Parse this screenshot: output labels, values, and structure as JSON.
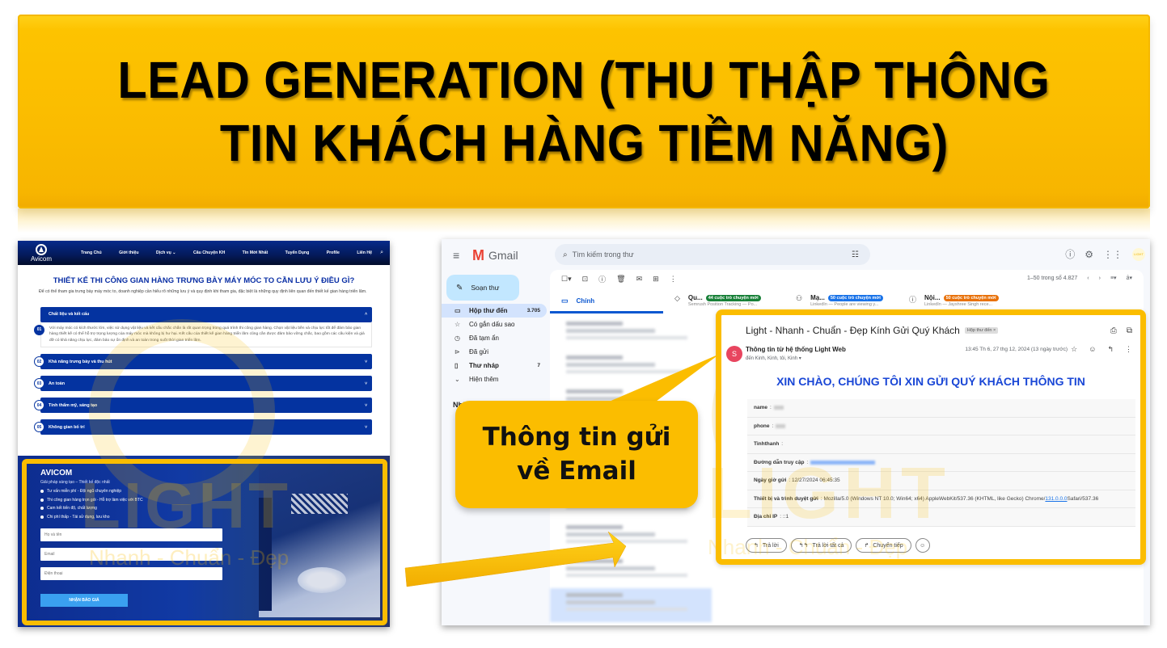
{
  "banner": {
    "line1": "LEAD GENERATION (THU THẬP THÔNG",
    "line2": "TIN KHÁCH HÀNG TIỀM NĂNG)"
  },
  "website": {
    "logo_text": "Avicom",
    "nav": [
      "Trang Chủ",
      "Giới thiệu",
      "Dịch vụ ⌄",
      "Câu Chuyện KH",
      "Tin Mới Nhất",
      "Tuyển Dụng",
      "Profile",
      "Liên Hệ"
    ],
    "title": "THIẾT KẾ THI CÔNG GIAN HÀNG TRƯNG BÀY MÁY MÓC TO CẦN LƯU Ý ĐIỀU GÌ?",
    "intro": "Để có thể tham gia trưng bày máy móc to, doanh nghiệp cần hiểu rõ những lưu ý và quy định khi tham gia, đặc biệt là những quy định liên quan đến thiết kế gian hàng triển lãm.",
    "accordion": [
      {
        "num": "01",
        "title": "Chất liệu và kết cấu",
        "open": true,
        "body": "Với máy móc có kích thước lớn, việc sử dụng vật liệu và kết cấu chắc chắn là rất quan trọng trong quá trình thi công gian hàng. Chọn vật liệu bền và chịu lực tốt để đảm bảo gian hàng thiết kế có thể hỗ trợ trọng lượng của máy móc mà không bị hư hại. Kết cấu của thiết kế gian hàng triển lãm cũng cần được đảm bảo vững chắc, bao gồm các cấu kiện và giá đỡ có khả năng chịu lực, đảm bảo sự ổn định và an toàn trong suốt thời gian triển lãm."
      },
      {
        "num": "02",
        "title": "Khả năng trưng bày và thu hút",
        "open": false
      },
      {
        "num": "03",
        "title": "An toàn",
        "open": false
      },
      {
        "num": "04",
        "title": "Tính thẩm mỹ, sáng tạo",
        "open": false
      },
      {
        "num": "05",
        "title": "Không gian bố trí",
        "open": false
      }
    ],
    "form": {
      "brand": "AVICOM",
      "subtitle": "Giải pháp sáng tạo – Thiết kế độc nhất",
      "bullets": [
        "Tư vấn miễn phí - Đội ngũ chuyên nghiệp",
        "Thi công gian hàng trọn gói - Hỗ trợ làm việc với BTC",
        "Cam kết tiến độ, chất lượng",
        "Chi phí thấp - Tái sử dụng, lưu kho"
      ],
      "name_placeholder": "Họ và tên",
      "email_placeholder": "Email",
      "phone_placeholder": "Điện thoại",
      "submit_label": "NHẬN BÁO GIÁ"
    }
  },
  "watermark": {
    "brand": "LIGHT",
    "slogan": "Nhanh - Chuẩn - Đẹp"
  },
  "gmail": {
    "brand": "Gmail",
    "search_placeholder": "Tìm kiếm trong thư",
    "compose_label": "Soạn thư",
    "nav": [
      {
        "icon": "inbox-icon",
        "glyph": "▭",
        "label": "Hộp thư đến",
        "count": "3.705",
        "active": true
      },
      {
        "icon": "star-icon",
        "glyph": "☆",
        "label": "Có gắn dấu sao",
        "count": ""
      },
      {
        "icon": "clock-icon",
        "glyph": "◷",
        "label": "Đã tạm ẩn",
        "count": ""
      },
      {
        "icon": "send-icon",
        "glyph": "⊳",
        "label": "Đã gửi",
        "count": ""
      },
      {
        "icon": "draft-icon",
        "glyph": "▯",
        "label": "Thư nháp",
        "count": "7",
        "bold": true
      },
      {
        "icon": "chevron-down-icon",
        "glyph": "⌄",
        "label": "Hiện thêm",
        "count": ""
      }
    ],
    "labels_heading": "Nhã",
    "pager_text": "1–50 trong số 4.827",
    "tabs": {
      "primary": "Chính",
      "promotions": {
        "name": "Qu...",
        "chip": "44 cuộc trò chuyện mới",
        "sub": "Semrush Position Tracking — Po..."
      },
      "social": {
        "name": "Mạ...",
        "chip": "50 cuộc trò chuyện mới",
        "sub": "LinkedIn — People are viewing y..."
      },
      "updates": {
        "name": "Nội...",
        "chip": "50 cuộc trò chuyện mới",
        "sub": "LinkedIn — Jayshree Singh rece..."
      }
    },
    "avatar_text": "LIGHT",
    "email": {
      "subject": "Light - Nhanh - Chuẩn - Đẹp Kính Gửi Quý Khách",
      "folder_badge": "Hộp thư đến ×",
      "sender_initial": "S",
      "sender": "Thông tin từ hệ thống Light Web",
      "recipients": "đến Kinh, Kinh, tôi, Kinh ▾",
      "date": "13:45 Th 6, 27 thg 12, 2024 (13 ngày trước)",
      "heading": "XIN CHÀO, CHÚNG TÔI XIN GỬI QUÝ KHÁCH THÔNG TIN",
      "fields": [
        {
          "label": "name",
          "value": "",
          "redacted": true
        },
        {
          "label": "phone",
          "value": "",
          "redacted": true
        },
        {
          "label": "Tinhthanh",
          "value": ""
        },
        {
          "label": "Đường dẫn truy cập",
          "value": "",
          "redacted_link": true
        },
        {
          "label": "Ngày giờ gửi",
          "value": "12/27/2024 06:45:35"
        },
        {
          "label": "Thiết bị và trình duyệt gửi",
          "value_pre": "Mozilla/5.0 (Windows NT 10.0; Win64; x64) AppleWebKit/537.36 (KHTML, like Gecko) Chrome/",
          "value_link": "131.0.0.0",
          "value_post": " Safari/537.36"
        },
        {
          "label": "Địa chỉ IP",
          "value": "::1"
        }
      ],
      "reply_label": "Trả lời",
      "reply_all_label": "Trả lời tất cả",
      "forward_label": "Chuyển tiếp"
    }
  },
  "callout": {
    "line1": "Thông tin gửi",
    "line2": "về Email"
  },
  "colors": {
    "accent_yellow": "#fbbd00",
    "site_blue": "#0433a0",
    "gmail_blue": "#0b57d0",
    "email_heading_blue": "#1a47d6"
  }
}
